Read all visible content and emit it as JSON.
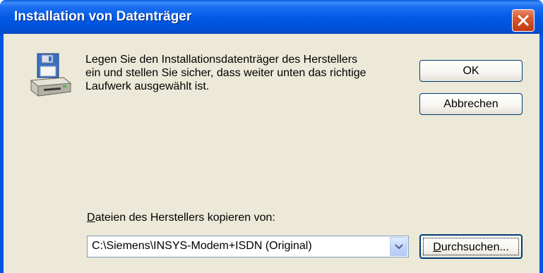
{
  "window": {
    "title": "Installation von Datenträger",
    "close_icon": "close-icon"
  },
  "message": {
    "text": "Legen Sie den Installationsdatenträger des Herstellers\nein und stellen Sie sicher, dass weiter unten das richtige\nLaufwerk ausgewählt ist.",
    "icon": "floppy-disk-drive-icon"
  },
  "buttons": {
    "ok_label": "OK",
    "cancel_label": "Abbrechen",
    "browse_label_prefix": "D",
    "browse_label_rest": "urchsuchen..."
  },
  "copy_from": {
    "label_prefix": "D",
    "label_rest": "ateien des Herstellers kopieren von:",
    "value": "C:\\Siemens\\INSYS-Modem+ISDN (Original)",
    "dropdown_icon": "chevron-down-icon"
  },
  "colors": {
    "titlebar": "#0054e3",
    "client_bg": "#ece9d8",
    "close_button": "#d9562b"
  }
}
